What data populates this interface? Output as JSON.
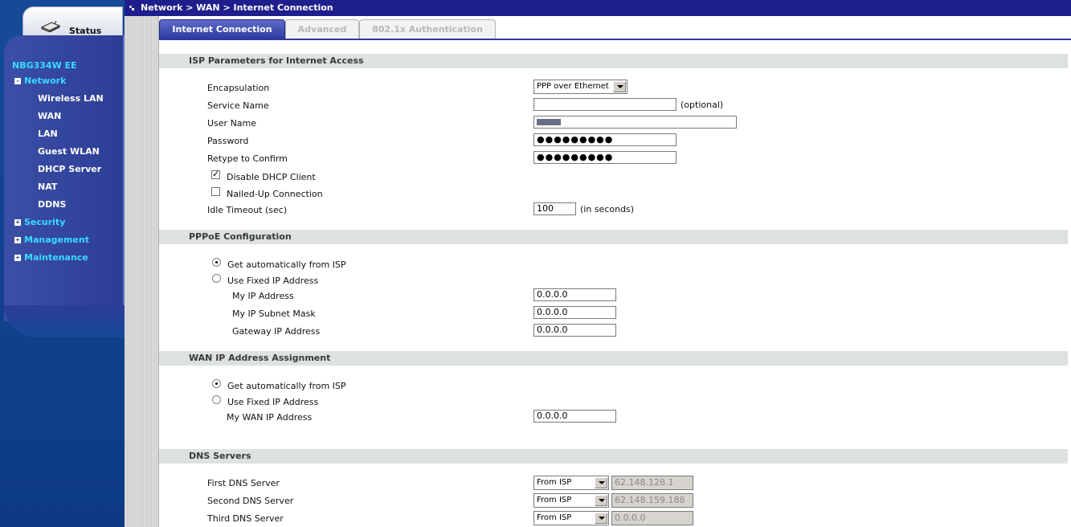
{
  "sidebar": {
    "status_label": "Status",
    "device": "NBG334W EE",
    "network_label": "Network",
    "network_items": [
      "Wireless LAN",
      "WAN",
      "LAN",
      "Guest WLAN",
      "DHCP Server",
      "NAT",
      "DDNS"
    ],
    "security_label": "Security",
    "management_label": "Management",
    "maintenance_label": "Maintenance",
    "expanded_glyph": "-",
    "collapsed_glyph": "+"
  },
  "breadcrumb": "Network > WAN > Internet Connection",
  "tabs": [
    "Internet Connection",
    "Advanced",
    "802.1x Authentication"
  ],
  "isp": {
    "title": "ISP Parameters for Internet Access",
    "encapsulation_label": "Encapsulation",
    "encapsulation_value": "PPP over Ethernet",
    "service_name_label": "Service Name",
    "service_name_value": "",
    "optional_note": "(optional)",
    "user_name_label": "User Name",
    "password_label": "Password",
    "password_value": "●●●●●●●●●",
    "retype_label": "Retype to Confirm",
    "retype_value": "●●●●●●●●●",
    "disable_dhcp_label": "Disable DHCP Client",
    "disable_dhcp_checked": true,
    "nailed_up_label": "Nailed-Up Connection",
    "nailed_up_checked": false,
    "idle_timeout_label": "Idle Timeout (sec)",
    "idle_timeout_value": "100",
    "idle_timeout_unit": "(in seconds)"
  },
  "pppoe": {
    "title": "PPPoE Configuration",
    "auto_label": "Get automatically from ISP",
    "fixed_label": "Use Fixed IP Address",
    "my_ip_label": "My IP Address",
    "my_ip_value": "0.0.0.0",
    "subnet_label": "My IP Subnet Mask",
    "subnet_value": "0.0.0.0",
    "gateway_label": "Gateway IP Address",
    "gateway_value": "0.0.0.0"
  },
  "wan": {
    "title": "WAN IP Address Assignment",
    "auto_label": "Get automatically from ISP",
    "fixed_label": "Use Fixed IP Address",
    "my_wan_label": "My WAN IP Address",
    "my_wan_value": "0.0.0.0"
  },
  "dns": {
    "title": "DNS Servers",
    "rows": [
      {
        "label": "First DNS Server",
        "mode": "From ISP",
        "value": "62.148.128.1"
      },
      {
        "label": "Second DNS Server",
        "mode": "From ISP",
        "value": "62.148.159.188"
      },
      {
        "label": "Third DNS Server",
        "mode": "From ISP",
        "value": "0.0.0.0"
      }
    ]
  },
  "colors": {
    "topbar": "#1e1e8c",
    "sidebar": "#164a98",
    "nav_highlight": "#37ddff",
    "section_bg": "#dde1e1"
  }
}
